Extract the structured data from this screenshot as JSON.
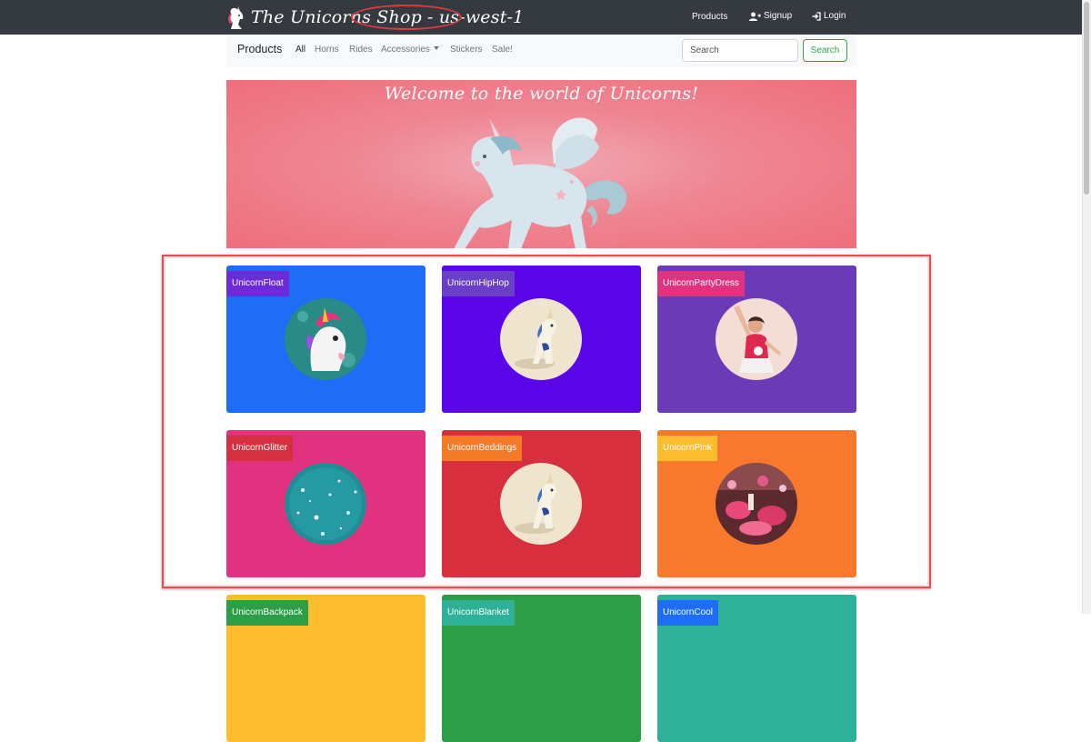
{
  "header": {
    "brand": "The Unicorns Shop",
    "region": "- us-west-1",
    "links": {
      "products": "Products",
      "signup": "Signup",
      "login": "Login"
    }
  },
  "subnav": {
    "title": "Products",
    "categories": [
      "All",
      "Horns",
      "Rides",
      "Accessories",
      "Stickers",
      "Sale!"
    ],
    "active_category": "All",
    "search_placeholder": "Search",
    "search_button": "Search"
  },
  "hero": {
    "title": "Welcome to the world of Unicorns!"
  },
  "products": [
    {
      "name": "UnicornFloat",
      "card_color": "#1f6df6",
      "badge_color": "#6c2bd9",
      "image": "inflatable-unicorn-float"
    },
    {
      "name": "UnicornHipHop",
      "card_color": "#5a06e8",
      "badge_color": "#6a3fc7",
      "image": "unicorn-figurine"
    },
    {
      "name": "UnicornPartyDress",
      "card_color": "#6a3ab7",
      "badge_color": "#e0327f",
      "image": "girl-in-party-dress"
    },
    {
      "name": "UnicornGlitter",
      "card_color": "#e0327f",
      "badge_color": "#d63040",
      "image": "teal-glitter"
    },
    {
      "name": "UnicornBeddings",
      "card_color": "#d72f3e",
      "badge_color": "#f47a26",
      "image": "unicorn-figurine"
    },
    {
      "name": "UnicornPink",
      "card_color": "#f8792c",
      "badge_color": "#fbbc2e",
      "image": "pink-party-decor"
    },
    {
      "name": "UnicornBackpack",
      "card_color": "#fdbc2e",
      "badge_color": "#2c9e47",
      "image": ""
    },
    {
      "name": "UnicornBlanket",
      "card_color": "#2c9e47",
      "badge_color": "#2fb197",
      "image": ""
    },
    {
      "name": "UnicornCool",
      "card_color": "#2fb197",
      "badge_color": "#1f6df6",
      "image": ""
    }
  ]
}
